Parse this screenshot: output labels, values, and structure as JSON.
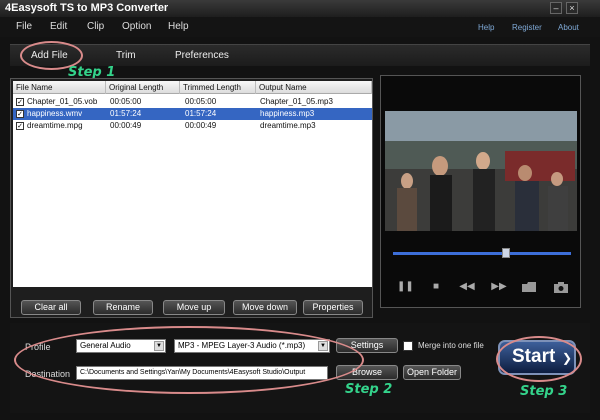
{
  "window": {
    "title": "4Easysoft TS to MP3 Converter",
    "min": "–",
    "close": "×"
  },
  "menu": [
    "File",
    "Edit",
    "Clip",
    "Option",
    "Help"
  ],
  "help_links": [
    "Help",
    "Register",
    "About"
  ],
  "tabs": [
    "Add File",
    "Trim",
    "Preferences"
  ],
  "steps": [
    "Step 1",
    "Step 2",
    "Step 3"
  ],
  "file_list": {
    "columns": [
      "File Name",
      "Original Length",
      "Trimmed Length",
      "Output Name"
    ],
    "rows": [
      {
        "name": "Chapter_01_05.vob",
        "orig": "00:05:00",
        "trim": "00:05:00",
        "out": "Chapter_01_05.mp3",
        "checked": "✓"
      },
      {
        "name": "happiness.wmv",
        "orig": "01:57:24",
        "trim": "01:57:24",
        "out": "happiness.mp3",
        "checked": "✓"
      },
      {
        "name": "dreamtime.mpg",
        "orig": "00:00:49",
        "trim": "00:00:49",
        "out": "dreamtime.mp3",
        "checked": "✓"
      }
    ]
  },
  "list_buttons": [
    "Clear all",
    "Rename",
    "Move up",
    "Move down",
    "Properties"
  ],
  "profile": {
    "label": "Profile",
    "category": "General Audio",
    "format": "MP3 - MPEG Layer-3 Audio (*.mp3)",
    "settings": "Settings",
    "merge": "Merge into one file"
  },
  "destination": {
    "label": "Destination",
    "path": "C:\\Documents and Settings\\Yan\\My Documents\\4Easysoft Studio\\Output",
    "browse": "Browse",
    "open": "Open Folder"
  },
  "start": "Start",
  "player_controls": [
    "❚❚",
    "■",
    "◀◀",
    "▶▶",
    "folder",
    "camera"
  ]
}
